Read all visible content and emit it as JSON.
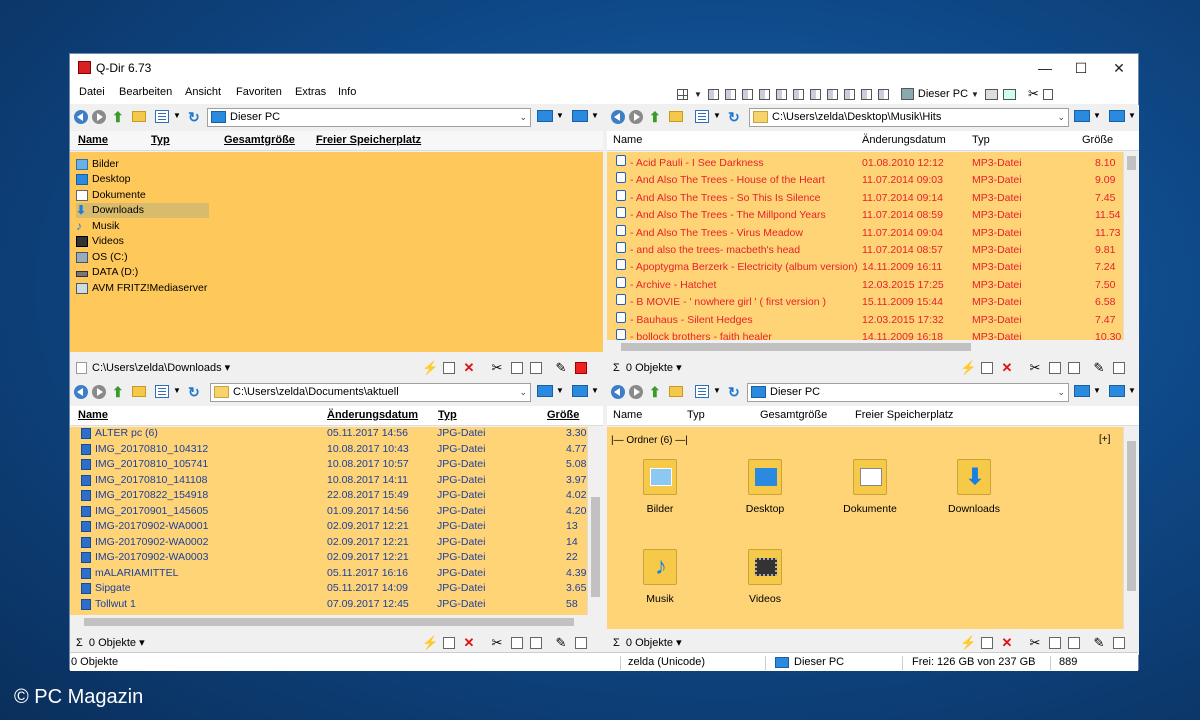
{
  "window": {
    "title": "Q-Dir 6.73",
    "controls": [
      "—",
      "☐",
      "✕"
    ]
  },
  "menu": [
    "Datei",
    "Bearbeiten",
    "Ansicht",
    "Favoriten",
    "Extras",
    "Info"
  ],
  "top_right": {
    "computer_label": "Dieser PC"
  },
  "pane1": {
    "address": "Dieser PC",
    "headers": [
      "Name",
      "Typ",
      "Gesamtgröße",
      "Freier Speicherplatz"
    ],
    "items": [
      {
        "label": "Bilder",
        "icon": "pictures-icon"
      },
      {
        "label": "Desktop",
        "icon": "desktop-icon"
      },
      {
        "label": "Dokumente",
        "icon": "documents-icon"
      },
      {
        "label": "Downloads",
        "icon": "downloads-icon"
      },
      {
        "label": "Musik",
        "icon": "music-icon"
      },
      {
        "label": "Videos",
        "icon": "videos-icon"
      },
      {
        "label": "OS (C:)",
        "icon": "drive-icon"
      },
      {
        "label": "DATA (D:)",
        "icon": "drive-icon"
      },
      {
        "label": "AVM FRITZ!Mediaserver",
        "icon": "mediaserver-icon"
      }
    ],
    "status_path": "C:\\Users\\zelda\\Downloads"
  },
  "pane2": {
    "address": "C:\\Users\\zelda\\Desktop\\Musik\\Hits",
    "headers": [
      "Name",
      "Änderungsdatum",
      "Typ",
      "Größe"
    ],
    "rows": [
      [
        "- Acid Pauli - I See Darkness",
        "01.08.2010 12:12",
        "MP3-Datei",
        "8.10"
      ],
      [
        "- And Also The Trees - House of the Heart",
        "11.07.2014 09:03",
        "MP3-Datei",
        "9.09"
      ],
      [
        "- And Also The Trees - So This Is Silence",
        "11.07.2014 09:14",
        "MP3-Datei",
        "7.45"
      ],
      [
        "- And Also The Trees - The Millpond Years",
        "11.07.2014 08:59",
        "MP3-Datei",
        "11.54"
      ],
      [
        "- And Also The Trees - Virus Meadow",
        "11.07.2014 09:04",
        "MP3-Datei",
        "11.73"
      ],
      [
        "- and also the trees- macbeth's head",
        "11.07.2014 08:57",
        "MP3-Datei",
        "9.81"
      ],
      [
        "- Apoptygma Berzerk - Electricity (album version)",
        "14.11.2009 16:11",
        "MP3-Datei",
        "7.24"
      ],
      [
        "- Archive - Hatchet",
        "12.03.2015 17:25",
        "MP3-Datei",
        "7.50"
      ],
      [
        "- B MOVIE - ' nowhere girl ' ( first version )",
        "15.11.2009 15:44",
        "MP3-Datei",
        "6.58"
      ],
      [
        "- Bauhaus - Silent Hedges",
        "12.03.2015 17:32",
        "MP3-Datei",
        "7.47"
      ],
      [
        "- bollock brothers - faith healer",
        "14.11.2009 16:18",
        "MP3-Datei",
        "10.30"
      ]
    ],
    "status": "0 Objekte"
  },
  "pane3": {
    "address": "C:\\Users\\zelda\\Documents\\aktuell",
    "headers": [
      "Name",
      "Änderungsdatum",
      "Typ",
      "Größe"
    ],
    "rows": [
      [
        "ALTER pc (6)",
        "05.11.2017 14:56",
        "JPG-Datei",
        "3.30"
      ],
      [
        "IMG_20170810_104312",
        "10.08.2017 10:43",
        "JPG-Datei",
        "4.77"
      ],
      [
        "IMG_20170810_105741",
        "10.08.2017 10:57",
        "JPG-Datei",
        "5.08"
      ],
      [
        "IMG_20170810_141108",
        "10.08.2017 14:11",
        "JPG-Datei",
        "3.97"
      ],
      [
        "IMG_20170822_154918",
        "22.08.2017 15:49",
        "JPG-Datei",
        "4.02"
      ],
      [
        "IMG_20170901_145605",
        "01.09.2017 14:56",
        "JPG-Datei",
        "4.20"
      ],
      [
        "IMG-20170902-WA0001",
        "02.09.2017 12:21",
        "JPG-Datei",
        "13"
      ],
      [
        "IMG-20170902-WA0002",
        "02.09.2017 12:21",
        "JPG-Datei",
        "14"
      ],
      [
        "IMG-20170902-WA0003",
        "02.09.2017 12:21",
        "JPG-Datei",
        "22"
      ],
      [
        "mALARIAMITTEL",
        "05.11.2017 16:16",
        "JPG-Datei",
        "4.39"
      ],
      [
        "Sipgate",
        "05.11.2017 14:09",
        "JPG-Datei",
        "3.65"
      ],
      [
        "Tollwut 1",
        "07.09.2017 12:45",
        "JPG-Datei",
        "58"
      ]
    ],
    "status": "0 Objekte"
  },
  "pane4": {
    "address": "Dieser PC",
    "headers": [
      "Name",
      "Typ",
      "Gesamtgröße",
      "Freier Speicherplatz"
    ],
    "group_label": "|— Ordner (6) —|",
    "group_toggle": "[+]",
    "items": [
      "Bilder",
      "Desktop",
      "Dokumente",
      "Downloads",
      "Musik",
      "Videos"
    ],
    "status": "0 Objekte"
  },
  "statusbar": {
    "left": "0 Objekte",
    "user": "zelda (Unicode)",
    "computer": "Dieser PC",
    "free": "Frei: 126 GB von 237 GB",
    "count": "889"
  },
  "watermark": "© PC Magazin",
  "colors": {
    "list_bg": "#ffd477",
    "selected_bg": "#d9bb6e",
    "mp3_text": "#e8202a",
    "jpg_text": "#1a3fa0"
  }
}
